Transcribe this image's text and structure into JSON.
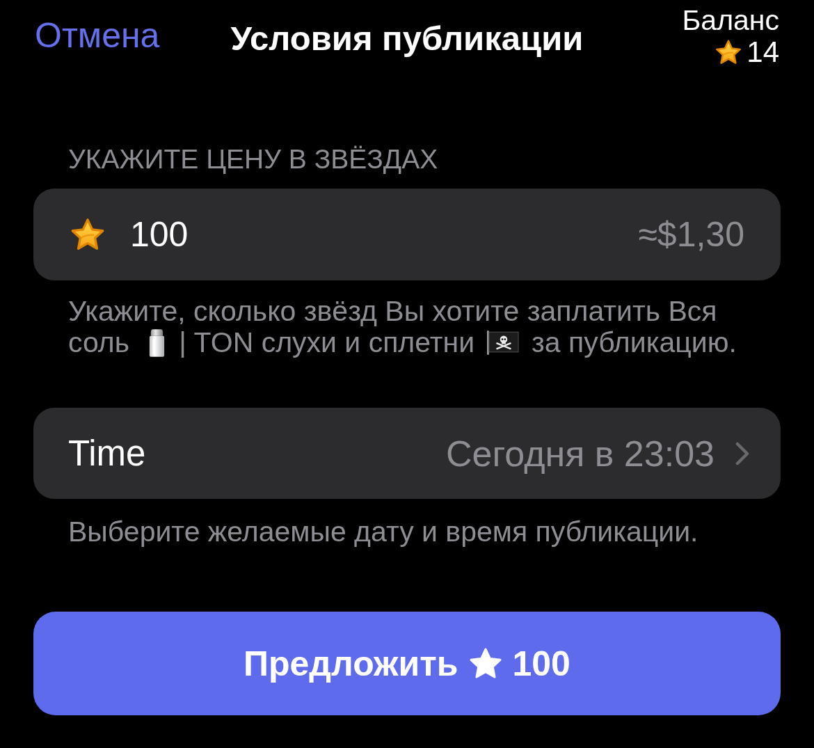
{
  "header": {
    "cancel": "Отмена",
    "title": "Условия публикации",
    "balance": {
      "label": "Баланс",
      "amount": "14"
    }
  },
  "price": {
    "section_label": "УКАЖИТЕ ЦЕНУ В ЗВЁЗДАХ",
    "value": "100",
    "converted": "≈$1,30",
    "hint_lines": [
      [
        {
          "kind": "text",
          "text": "Укажите, сколько звёзд Вы хотите заплатить Вся"
        }
      ],
      [
        {
          "kind": "text",
          "text": "соль"
        },
        {
          "kind": "salt"
        },
        {
          "kind": "text",
          "text": "| TON слухи и сплетни"
        },
        {
          "kind": "flag"
        },
        {
          "kind": "text",
          "text": "за публикацию."
        }
      ]
    ]
  },
  "schedule": {
    "label": "Time",
    "value": "Сегодня в 23:03",
    "hint": "Выберите желаемые дату и время публикации."
  },
  "submit": {
    "label": "Предложить",
    "amount": "100"
  }
}
